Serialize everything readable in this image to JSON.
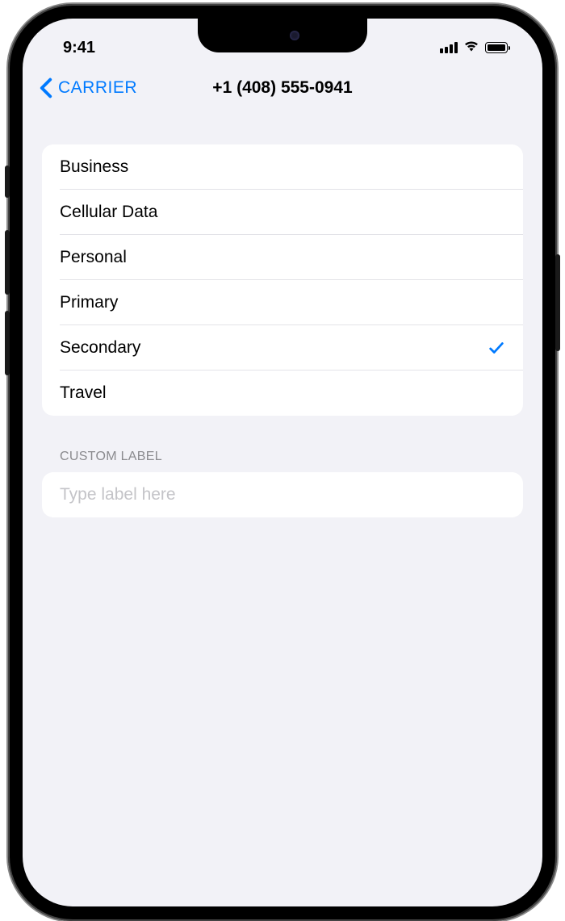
{
  "status_bar": {
    "time": "9:41"
  },
  "nav": {
    "back_label": "CARRIER",
    "title": "+1 (408) 555-0941"
  },
  "labels": [
    {
      "name": "Business",
      "selected": false
    },
    {
      "name": "Cellular Data",
      "selected": false
    },
    {
      "name": "Personal",
      "selected": false
    },
    {
      "name": "Primary",
      "selected": false
    },
    {
      "name": "Secondary",
      "selected": true
    },
    {
      "name": "Travel",
      "selected": false
    }
  ],
  "custom_label": {
    "header": "CUSTOM LABEL",
    "placeholder": "Type label here",
    "value": ""
  }
}
